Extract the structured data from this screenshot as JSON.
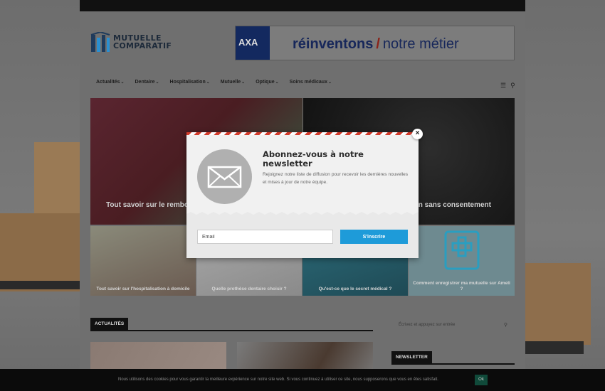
{
  "site": {
    "logo_line1": "MUTUELLE",
    "logo_line2": "COMPARATIF",
    "banner": {
      "brand": "AXA",
      "text_bold": "réinventons",
      "slash": "/",
      "text_rest": "notre métier"
    }
  },
  "nav": {
    "items": [
      "Actualités",
      "Dentaire",
      "Hospitalisation",
      "Mutuelle",
      "Optique",
      "Soins médicaux"
    ],
    "chevron": "⌄"
  },
  "hero": [
    {
      "title": "Tout savoir sur le rembou"
    },
    {
      "title": "on sans consentement"
    }
  ],
  "tiles": [
    {
      "title": "Tout savoir sur l'hospitalisation à domicile"
    },
    {
      "title": "Quelle prothèse dentaire choisir ?"
    },
    {
      "title": "Qu'est-ce que le secret médical ?"
    },
    {
      "title": "Comment enregistrer ma mutuelle sur Ameli ?"
    }
  ],
  "sections": {
    "news_label": "ACTUALITÉS",
    "newsletter_label": "NEWSLETTER"
  },
  "search": {
    "placeholder": "Écrivez et appuyez sur entrée"
  },
  "popup": {
    "close": "×",
    "title": "Abonnez-vous à notre newsletter",
    "description": "Rejoignez notre liste de diffusion pour recevoir les dernières nouvelles et mises à jour de notre équipe.",
    "email_placeholder": "Email",
    "subscribe_label": "S'inscrire"
  },
  "cookie": {
    "text": "Nous utilisons des cookies pour vous garantir la meilleure expérience sur notre site web. Si vous continuez à utiliser ce site, nous supposerons que vous en êtes satisfait.",
    "ok_label": "Ok"
  },
  "colors": {
    "accent": "#1e9bd9",
    "stripe_red": "#d23a2a",
    "axa_blue": "#13295f"
  }
}
